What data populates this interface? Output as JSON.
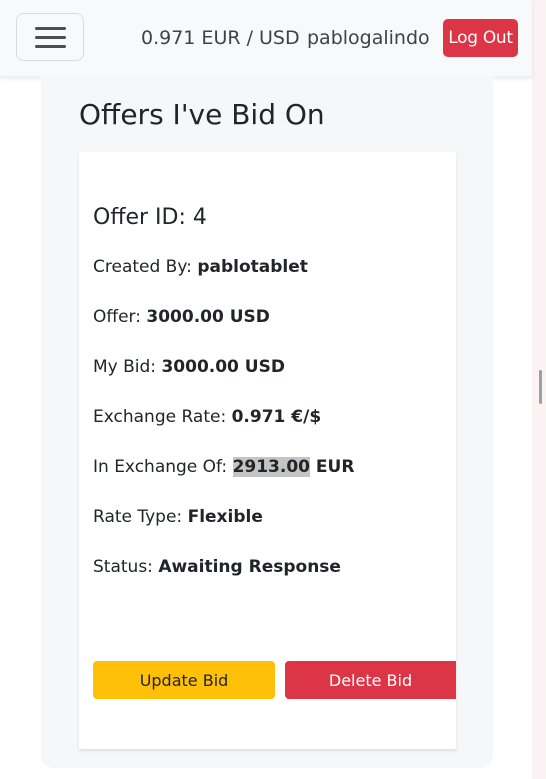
{
  "navbar": {
    "exchange_rate": "0.971 EUR / USD",
    "username": "pablogalindo",
    "logout_label": "Log Out"
  },
  "panel": {
    "title": "Offers I've Bid On"
  },
  "offer": {
    "heading": "Offer ID: 4",
    "created_by_label": "Created By:",
    "created_by_value": "pablotablet",
    "offer_label": "Offer:",
    "offer_value": "3000.00 USD",
    "my_bid_label": "My Bid:",
    "my_bid_value": "3000.00 USD",
    "exchange_rate_label": "Exchange Rate:",
    "exchange_rate_value": "0.971 €/$",
    "in_exchange_label": "In Exchange Of:",
    "in_exchange_amount": "2913.00",
    "in_exchange_currency": "EUR",
    "rate_type_label": "Rate Type:",
    "rate_type_value": "Flexible",
    "status_label": "Status:",
    "status_value": "Awaiting Response"
  },
  "actions": {
    "update_label": "Update Bid",
    "delete_label": "Delete Bid"
  },
  "colors": {
    "danger": "#dc3545",
    "warning": "#ffc107",
    "navbar_bg": "#f8f9fa"
  }
}
